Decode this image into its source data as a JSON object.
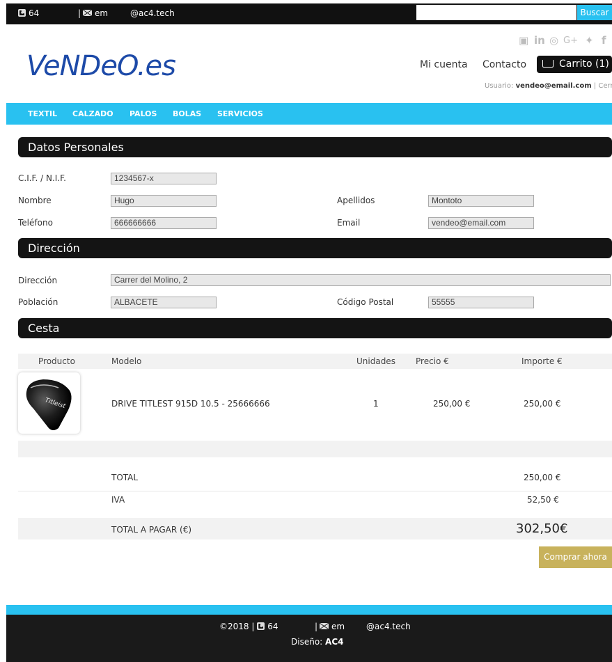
{
  "topbar": {
    "phone": "64",
    "email": "em",
    "handle": "@ac4.tech",
    "search_placeholder": "",
    "search_button": "Buscar"
  },
  "header": {
    "logo": "VeNDeO.es",
    "social_icons": [
      "youtube-icon",
      "linkedin-icon",
      "instagram-icon",
      "googleplus-icon",
      "twitter-icon",
      "facebook-icon"
    ],
    "my_account": "Mi cuenta",
    "contact": "Contacto",
    "cart": "Carrito (1)",
    "user_label": "Usuario:",
    "user_email": "vendeo@email.com",
    "separator": "|",
    "logout": "Cerrar"
  },
  "nav": [
    "TEXTIL",
    "CALZADO",
    "PALOS",
    "BOLAS",
    "SERVICIOS"
  ],
  "personal": {
    "title": "Datos Personales",
    "nif_label": "C.I.F. / N.I.F.",
    "nif_value": "1234567-x",
    "name_label": "Nombre",
    "name_value": "Hugo",
    "surname_label": "Apellidos",
    "surname_value": "Montoto",
    "phone_label": "Teléfono",
    "phone_value": "666666666",
    "email_label": "Email",
    "email_value": "vendeo@email.com"
  },
  "address": {
    "title": "Dirección",
    "address_label": "Dirección",
    "address_value": "Carrer del Molino, 2",
    "city_label": "Población",
    "city_value": "ALBACETE",
    "zip_label": "Código Postal",
    "zip_value": "55555"
  },
  "cart": {
    "title": "Cesta",
    "headers": [
      "Producto",
      "Modelo",
      "Unidades",
      "Precio €",
      "Importe €"
    ],
    "item": {
      "model": "DRIVE TITLEST 915D 10.5 - 25666666",
      "units": "1",
      "price": "250,00 €",
      "amount": "250,00 €"
    },
    "total_label": "TOTAL",
    "total_value": "250,00 €",
    "iva_label": "IVA",
    "iva_value": "52,50 €",
    "pay_label": "TOTAL A PAGAR (€)",
    "pay_value": "302,50€",
    "buy_button": "Comprar ahora"
  },
  "footer": {
    "copyright": "©2018 |",
    "phone": "64",
    "email": "em",
    "handle": "@ac4.tech",
    "design_label": "Diseño:",
    "design_value": "AC4"
  },
  "colors": {
    "accent": "#29c1f0",
    "dark": "#141414",
    "buy": "#c8b25c",
    "logo": "#1d4aa8"
  }
}
